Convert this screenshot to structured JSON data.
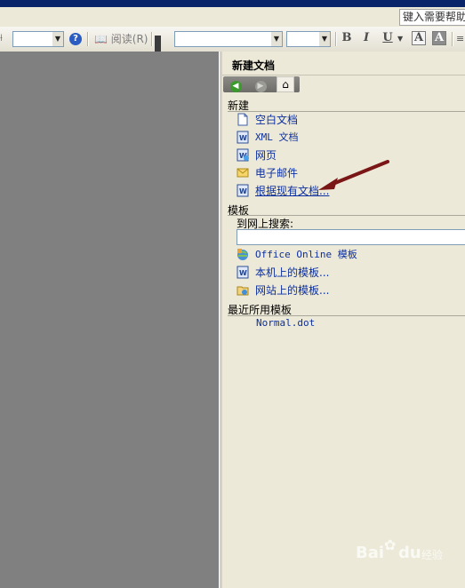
{
  "menubar": {
    "help_placeholder": "键入需要帮助"
  },
  "toolbar": {
    "read_label": "阅读(R)",
    "style_combo_value": "",
    "font_combo_value": "",
    "size_combo_value": "",
    "bold": "B",
    "italic": "I",
    "underline": "U",
    "font_color": "A",
    "highlight": "A"
  },
  "task_pane": {
    "title": "新建文档",
    "sections": {
      "new": {
        "heading": "新建",
        "items": [
          {
            "label": "空白文档",
            "icon": "blank-doc-icon"
          },
          {
            "label": "XML 文档",
            "icon": "xml-doc-icon"
          },
          {
            "label": "网页",
            "icon": "web-page-icon"
          },
          {
            "label": "电子邮件",
            "icon": "email-icon"
          },
          {
            "label": "根据现有文档...",
            "icon": "existing-doc-icon"
          }
        ]
      },
      "templates": {
        "heading": "模板",
        "search_label": "到网上搜索:",
        "search_value": "",
        "items": [
          {
            "label": "Office Online 模板",
            "icon": "office-online-icon"
          },
          {
            "label": "本机上的模板...",
            "icon": "local-template-icon"
          },
          {
            "label": "网站上的模板...",
            "icon": "website-template-icon"
          }
        ]
      },
      "recent": {
        "heading": "最近所用模板",
        "items": [
          "Normal.dot"
        ]
      }
    }
  },
  "watermark": {
    "text": "Bai",
    "text2": "du",
    "sub": "经验"
  },
  "colors": {
    "link": "#0b2fa0",
    "pane_bg": "#ece9d8",
    "doc_bg": "#808080",
    "arrow": "#7a1616"
  }
}
